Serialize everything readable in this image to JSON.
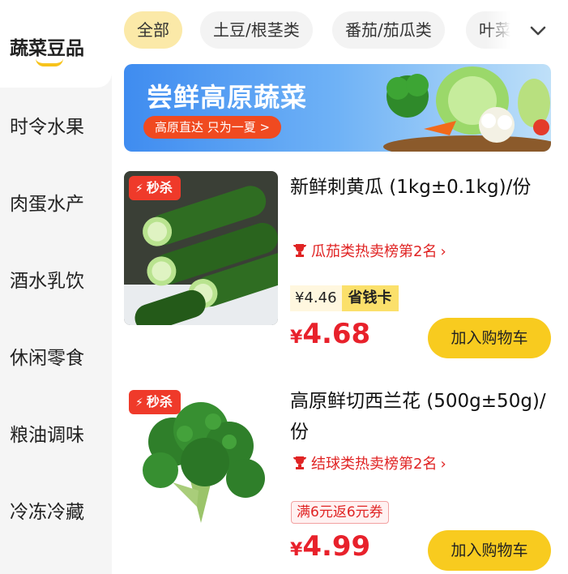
{
  "sidebar": {
    "items": [
      {
        "label": "蔬菜豆品",
        "active": true
      },
      {
        "label": "时令水果"
      },
      {
        "label": "肉蛋水产"
      },
      {
        "label": "酒水乳饮"
      },
      {
        "label": "休闲零食"
      },
      {
        "label": "粮油调味"
      },
      {
        "label": "冷冻冷藏"
      }
    ]
  },
  "filters": {
    "chips": [
      {
        "label": "全部",
        "active": true
      },
      {
        "label": "土豆/根茎类"
      },
      {
        "label": "番茄/茄瓜类"
      },
      {
        "label": "叶菜"
      }
    ],
    "expand_icon": "chevron-down-icon"
  },
  "banner": {
    "title": "尝鲜高原蔬菜",
    "pill": "高原直达 只为一夏 >"
  },
  "products": [
    {
      "title": "新鲜刺黄瓜 (1kg±0.1kg)/份",
      "badge": "秒杀",
      "rank": "瓜茄类热卖榜第2名",
      "member_price": "¥4.46",
      "member_card": "省钱卡",
      "price_symbol": "¥",
      "price": "4.68",
      "cart_label": "加入购物车",
      "image": "cucumber"
    },
    {
      "title": "高原鲜切西兰花 (500g±50g)/份",
      "badge": "秒杀",
      "rank": "结球类热卖榜第2名",
      "coupon": "满6元返6元券",
      "price_symbol": "¥",
      "price": "4.99",
      "cart_label": "加入购物车",
      "image": "broccoli"
    }
  ],
  "colors": {
    "accent_yellow": "#f8cb1f",
    "price_red": "#e8212b",
    "badge_red": "#ef3a2a",
    "chip_active": "#fbe9a8"
  }
}
